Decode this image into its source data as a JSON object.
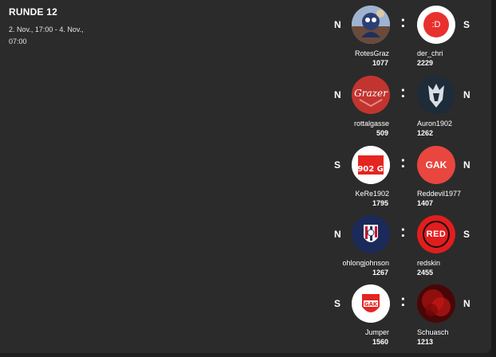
{
  "round": {
    "title": "RUNDE 12",
    "dates": "2. Nov., 17:00 - 4. Nov., 07:00"
  },
  "matches": [
    {
      "left": {
        "result": "N",
        "name": "RotesGraz",
        "score": "1077",
        "avatar": "cartoon-avatar"
      },
      "right": {
        "result": "S",
        "name": "der_chri",
        "score": "2229",
        "avatar": "smiley-avatar",
        "avatar_text": ":D"
      }
    },
    {
      "left": {
        "result": "N",
        "name": "rottalgasse",
        "score": "509",
        "avatar": "grazer-logo",
        "avatar_text": "Grazer"
      },
      "right": {
        "result": "N",
        "name": "Auron1902",
        "score": "1262",
        "avatar": "knight-avatar"
      }
    },
    {
      "left": {
        "result": "S",
        "name": "KeRe1902",
        "score": "1795",
        "avatar": "ga-1902-logo",
        "avatar_text": "1902 GA"
      },
      "right": {
        "result": "N",
        "name": "Reddevil1977",
        "score": "1407",
        "avatar": "gak-red-logo",
        "avatar_text": "GAK"
      }
    },
    {
      "left": {
        "result": "N",
        "name": "ohlongjohnson",
        "score": "1267",
        "avatar": "club-crest"
      },
      "right": {
        "result": "S",
        "name": "redskin",
        "score": "2455",
        "avatar": "red-logo",
        "avatar_text": "RED"
      }
    },
    {
      "left": {
        "result": "S",
        "name": "Jumper",
        "score": "1560",
        "avatar": "gak-crest",
        "avatar_text": "GAK"
      },
      "right": {
        "result": "N",
        "name": "Schuasch",
        "score": "1213",
        "avatar": "red-smoke-avatar"
      }
    }
  ],
  "separator": ":",
  "colors": {
    "background": "#2b2b2b",
    "red": "#e8302e",
    "text": "#ffffff"
  }
}
